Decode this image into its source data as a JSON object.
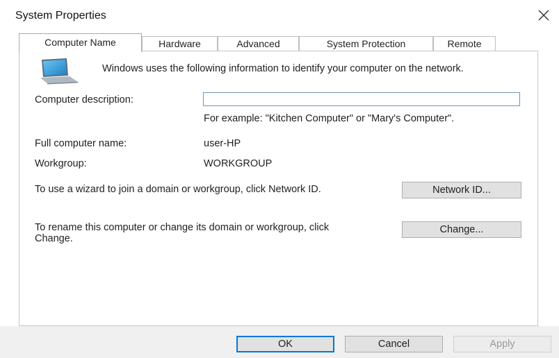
{
  "window": {
    "title": "System Properties",
    "close_glyph": "✕"
  },
  "tabs": [
    {
      "label": "Computer Name",
      "active": true
    },
    {
      "label": "Hardware",
      "active": false
    },
    {
      "label": "Advanced",
      "active": false
    },
    {
      "label": "System Protection",
      "active": false
    },
    {
      "label": "Remote",
      "active": false
    }
  ],
  "computer_name": {
    "intro": "Windows uses the following information to identify your computer on the network.",
    "description_label": "Computer description:",
    "description_value": "",
    "description_hint": "For example: \"Kitchen Computer\" or \"Mary's Computer\".",
    "full_name_label": "Full computer name:",
    "full_name_value": "user-HP",
    "workgroup_label": "Workgroup:",
    "workgroup_value": "WORKGROUP",
    "network_id_text": "To use a wizard to join a domain or workgroup, click Network ID.",
    "network_id_button": "Network ID...",
    "change_text": "To rename this computer or change its domain or workgroup, click Change.",
    "change_button": "Change..."
  },
  "footer": {
    "ok": "OK",
    "cancel": "Cancel",
    "apply": "Apply"
  },
  "icons": {
    "computer": "computer-icon",
    "close": "close-icon"
  },
  "colors": {
    "accent": "#0078d7",
    "input_border": "#6f93b8",
    "footer_bg": "#f0f0f0"
  }
}
